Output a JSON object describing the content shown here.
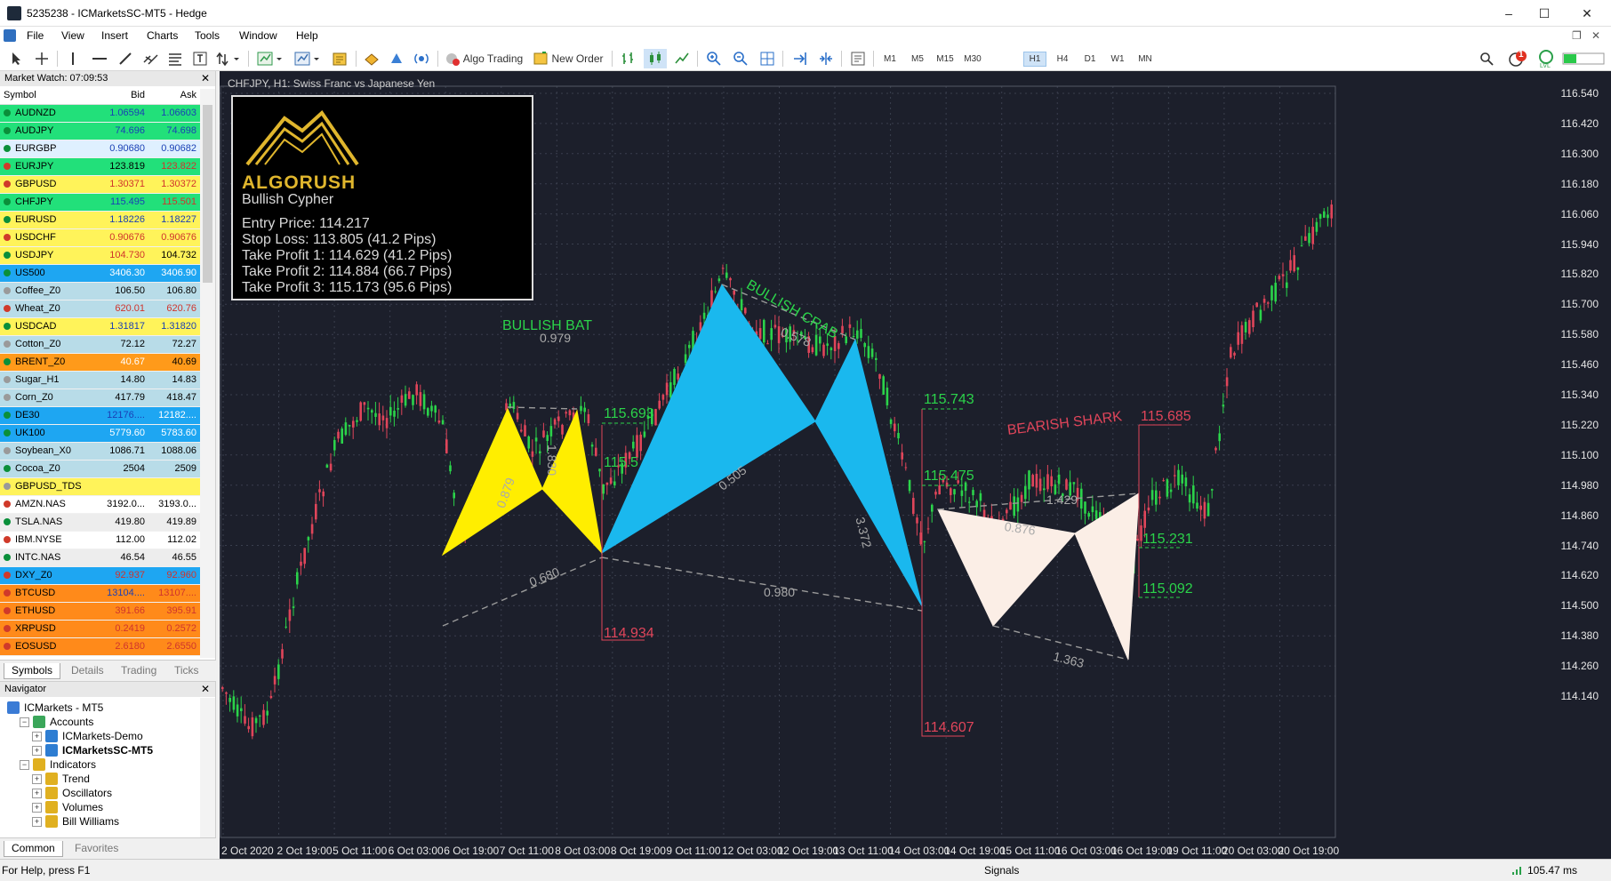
{
  "window": {
    "title": "5235238 - ICMarketsSC-MT5 - Hedge"
  },
  "menu": [
    "File",
    "View",
    "Insert",
    "Charts",
    "Tools",
    "Window",
    "Help"
  ],
  "toolbar": {
    "algo_trading": "Algo Trading",
    "new_order": "New Order",
    "timeframes": [
      "M1",
      "M5",
      "M15",
      "M30",
      "H1",
      "H4",
      "D1",
      "W1",
      "MN"
    ],
    "active_timeframe": "H1",
    "notification_count": "1",
    "lvl_label": "LVL"
  },
  "market_watch": {
    "title": "Market Watch: 07:09:53",
    "columns": [
      "Symbol",
      "Bid",
      "Ask"
    ],
    "rows": [
      {
        "symbol": "AUDNZD",
        "bid": "1.06594",
        "ask": "1.06603",
        "bg": "#22e07a",
        "dot": "#0a8f3a",
        "bidc": "#1a3fb5",
        "askc": "#1a3fb5"
      },
      {
        "symbol": "AUDJPY",
        "bid": "74.696",
        "ask": "74.698",
        "bg": "#22e07a",
        "dot": "#0a8f3a",
        "bidc": "#1a3fb5",
        "askc": "#1a3fb5"
      },
      {
        "symbol": "EURGBP",
        "bid": "0.90680",
        "ask": "0.90682",
        "bg": "#dff0ff",
        "dot": "#0a8f3a",
        "bidc": "#1a3fb5",
        "askc": "#1a3fb5"
      },
      {
        "symbol": "EURJPY",
        "bid": "123.819",
        "ask": "123.822",
        "bg": "#22e07a",
        "dot": "#d03a2a",
        "bidc": "#000000",
        "askc": "#d0342c"
      },
      {
        "symbol": "GBPUSD",
        "bid": "1.30371",
        "ask": "1.30372",
        "bg": "#fff35a",
        "dot": "#d03a2a",
        "bidc": "#d0342c",
        "askc": "#d0342c"
      },
      {
        "symbol": "CHFJPY",
        "bid": "115.495",
        "ask": "115.501",
        "bg": "#22e07a",
        "dot": "#0a8f3a",
        "bidc": "#1a3fb5",
        "askc": "#d0342c"
      },
      {
        "symbol": "EURUSD",
        "bid": "1.18226",
        "ask": "1.18227",
        "bg": "#fff35a",
        "dot": "#0a8f3a",
        "bidc": "#1a3fb5",
        "askc": "#1a3fb5"
      },
      {
        "symbol": "USDCHF",
        "bid": "0.90676",
        "ask": "0.90676",
        "bg": "#fff35a",
        "dot": "#d03a2a",
        "bidc": "#d0342c",
        "askc": "#d0342c"
      },
      {
        "symbol": "USDJPY",
        "bid": "104.730",
        "ask": "104.732",
        "bg": "#fff35a",
        "dot": "#0a8f3a",
        "bidc": "#d0342c",
        "askc": "#000000"
      },
      {
        "symbol": "US500",
        "bid": "3406.30",
        "ask": "3406.90",
        "bg": "#1ea6f2",
        "dot": "#0a8f3a",
        "bidc": "#ffffff",
        "askc": "#ffffff"
      },
      {
        "symbol": "Coffee_Z0",
        "bid": "106.50",
        "ask": "106.80",
        "bg": "#b8dce8",
        "dot": "#9a9a9a",
        "bidc": "#000000",
        "askc": "#000000"
      },
      {
        "symbol": "Wheat_Z0",
        "bid": "620.01",
        "ask": "620.76",
        "bg": "#b8dce8",
        "dot": "#d03a2a",
        "bidc": "#d0342c",
        "askc": "#d0342c"
      },
      {
        "symbol": "USDCAD",
        "bid": "1.31817",
        "ask": "1.31820",
        "bg": "#fff35a",
        "dot": "#0a8f3a",
        "bidc": "#1a3fb5",
        "askc": "#1a3fb5"
      },
      {
        "symbol": "Cotton_Z0",
        "bid": "72.12",
        "ask": "72.27",
        "bg": "#b8dce8",
        "dot": "#9a9a9a",
        "bidc": "#000000",
        "askc": "#000000"
      },
      {
        "symbol": "BRENT_Z0",
        "bid": "40.67",
        "ask": "40.69",
        "bg": "#ff9a1a",
        "dot": "#0a8f3a",
        "bidc": "#ffffff",
        "askc": "#000000"
      },
      {
        "symbol": "Sugar_H1",
        "bid": "14.80",
        "ask": "14.83",
        "bg": "#b8dce8",
        "dot": "#9a9a9a",
        "bidc": "#000000",
        "askc": "#000000"
      },
      {
        "symbol": "Corn_Z0",
        "bid": "417.79",
        "ask": "418.47",
        "bg": "#b8dce8",
        "dot": "#9a9a9a",
        "bidc": "#000000",
        "askc": "#000000"
      },
      {
        "symbol": "DE30",
        "bid": "12176....",
        "ask": "12182....",
        "bg": "#1ea6f2",
        "dot": "#0a8f3a",
        "bidc": "#1a3fb5",
        "askc": "#ffffff"
      },
      {
        "symbol": "UK100",
        "bid": "5779.60",
        "ask": "5783.60",
        "bg": "#1ea6f2",
        "dot": "#0a8f3a",
        "bidc": "#ffffff",
        "askc": "#ffffff"
      },
      {
        "symbol": "Soybean_X0",
        "bid": "1086.71",
        "ask": "1088.06",
        "bg": "#b8dce8",
        "dot": "#9a9a9a",
        "bidc": "#000000",
        "askc": "#000000"
      },
      {
        "symbol": "Cocoa_Z0",
        "bid": "2504",
        "ask": "2509",
        "bg": "#b8dce8",
        "dot": "#0a8f3a",
        "bidc": "#000000",
        "askc": "#000000"
      },
      {
        "symbol": "GBPUSD_TDS",
        "bid": "",
        "ask": "",
        "bg": "#fff35a",
        "dot": "#9a9a9a",
        "bidc": "#000000",
        "askc": "#000000"
      },
      {
        "symbol": "AMZN.NAS",
        "bid": "3192.0...",
        "ask": "3193.0...",
        "bg": "#ffffff",
        "dot": "#d03a2a",
        "bidc": "#000000",
        "askc": "#000000"
      },
      {
        "symbol": "TSLA.NAS",
        "bid": "419.80",
        "ask": "419.89",
        "bg": "#ededed",
        "dot": "#0a8f3a",
        "bidc": "#000000",
        "askc": "#000000"
      },
      {
        "symbol": "IBM.NYSE",
        "bid": "112.00",
        "ask": "112.02",
        "bg": "#ffffff",
        "dot": "#d03a2a",
        "bidc": "#000000",
        "askc": "#000000"
      },
      {
        "symbol": "INTC.NAS",
        "bid": "46.54",
        "ask": "46.55",
        "bg": "#ededed",
        "dot": "#0a8f3a",
        "bidc": "#000000",
        "askc": "#000000"
      },
      {
        "symbol": "DXY_Z0",
        "bid": "92.937",
        "ask": "92.960",
        "bg": "#1ea6f2",
        "dot": "#d03a2a",
        "bidc": "#d0342c",
        "askc": "#d0342c"
      },
      {
        "symbol": "BTCUSD",
        "bid": "13104....",
        "ask": "13107....",
        "bg": "#ff8a1a",
        "dot": "#d03a2a",
        "bidc": "#1a3fb5",
        "askc": "#d0342c"
      },
      {
        "symbol": "ETHUSD",
        "bid": "391.66",
        "ask": "395.91",
        "bg": "#ff8a1a",
        "dot": "#d03a2a",
        "bidc": "#d0342c",
        "askc": "#d0342c"
      },
      {
        "symbol": "XRPUSD",
        "bid": "0.2419",
        "ask": "0.2572",
        "bg": "#ff8a1a",
        "dot": "#d03a2a",
        "bidc": "#d0342c",
        "askc": "#d0342c"
      },
      {
        "symbol": "EOSUSD",
        "bid": "2.6180",
        "ask": "2.6550",
        "bg": "#ff8a1a",
        "dot": "#d03a2a",
        "bidc": "#d0342c",
        "askc": "#d0342c"
      }
    ],
    "tabs": [
      "Symbols",
      "Details",
      "Trading",
      "Ticks"
    ]
  },
  "navigator": {
    "title": "Navigator",
    "items": [
      {
        "label": "ICMarkets - MT5",
        "exp": "",
        "bold": false,
        "icon": "#3a7bd5"
      },
      {
        "label": "Accounts",
        "exp": "−",
        "bold": false,
        "icon": "#3aa65a"
      },
      {
        "label": "ICMarkets-Demo",
        "exp": "+",
        "bold": false,
        "icon": "#2d7dd2"
      },
      {
        "label": "ICMarketsSC-MT5",
        "exp": "+",
        "bold": true,
        "icon": "#2d7dd2"
      },
      {
        "label": "Indicators",
        "exp": "−",
        "bold": false,
        "icon": "#e0b020"
      },
      {
        "label": "Trend",
        "exp": "+",
        "bold": false,
        "icon": "#e0b020"
      },
      {
        "label": "Oscillators",
        "exp": "+",
        "bold": false,
        "icon": "#e0b020"
      },
      {
        "label": "Volumes",
        "exp": "+",
        "bold": false,
        "icon": "#e0b020"
      },
      {
        "label": "Bill Williams",
        "exp": "+",
        "bold": false,
        "icon": "#e0b020"
      }
    ],
    "tabs": [
      "Common",
      "Favorites"
    ]
  },
  "chart": {
    "title": "CHFJPY, H1:  Swiss Franc vs Japanese Yen",
    "infobox": {
      "brand": "ALGORUSH",
      "pattern": "Bullish Cypher",
      "entry": "Entry Price: 114.217",
      "stop": "Stop Loss: 113.805 (41.2 Pips)",
      "tp1": "Take Profit 1: 114.629 (41.2 Pips)",
      "tp2": "Take Profit 2: 114.884 (66.7 Pips)",
      "tp3": "Take Profit 3: 115.173 (95.6 Pips)"
    },
    "patterns": {
      "bat": "BULLISH BAT",
      "crab": "BULLISH CRAB",
      "shark": "BEARISH SHARK"
    },
    "ratios": {
      "bat_xb": "0.979",
      "bat_ad": "1.830",
      "bat_xd": "0.680",
      "crab_xb": "0.578",
      "crab_ac": "0.505",
      "crab_bd": "3.372",
      "big_xd": "0.980",
      "shark_ab": "1.429",
      "shark_bc": "0.876",
      "shark_xd": "1.363",
      "bat_xa": "0.879",
      "bat_ab": "0.618"
    },
    "level_labels": {
      "l115_693": "115.693",
      "l115_743": "115.743",
      "l115_475": "115.475",
      "l115_685": "115.685",
      "l115_231": "115.231",
      "l114_934": "114.934",
      "l114_607": "114.607",
      "l115_092": "115.092",
      "l115_5": "115.5"
    },
    "price_ticks": [
      "116.540",
      "116.420",
      "116.300",
      "116.180",
      "116.060",
      "115.940",
      "115.820",
      "115.700",
      "115.580",
      "115.460",
      "115.340",
      "115.220",
      "115.100",
      "114.980",
      "114.860",
      "114.740",
      "114.620",
      "114.500",
      "114.380",
      "114.260",
      "114.140"
    ],
    "time_ticks": [
      "2 Oct 2020",
      "2 Oct 19:00",
      "5 Oct 11:00",
      "6 Oct 03:00",
      "6 Oct 19:00",
      "7 Oct 11:00",
      "8 Oct 03:00",
      "8 Oct 19:00",
      "9 Oct 11:00",
      "12 Oct 03:00",
      "12 Oct 19:00",
      "13 Oct 11:00",
      "14 Oct 03:00",
      "14 Oct 19:00",
      "15 Oct 11:00",
      "16 Oct 03:00",
      "16 Oct 19:00",
      "19 Oct 11:00",
      "20 Oct 03:00",
      "20 Oct 19:00"
    ],
    "colors": {
      "bg": "#1c1f2b",
      "bull": "#2bd34a",
      "bear": "#e0455a",
      "bat": "#ffee00",
      "crab": "#1ab8ee",
      "shark": "#fbeee6"
    }
  },
  "status": {
    "help": "For Help, press F1",
    "signals": "Signals",
    "ping": "105.47 ms"
  }
}
